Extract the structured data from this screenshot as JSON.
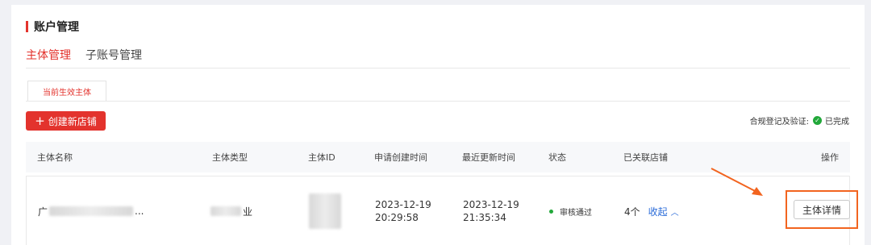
{
  "section": {
    "title": "账户管理"
  },
  "tabs": [
    {
      "label": "主体管理",
      "active": true
    },
    {
      "label": "子账号管理",
      "active": false
    }
  ],
  "subtab": {
    "label": "当前生效主体"
  },
  "toolbar": {
    "create_label": "创建新店铺",
    "compliance_label": "合规登记及验证:",
    "compliance_status": "已完成"
  },
  "table": {
    "headers": [
      "主体名称",
      "主体类型",
      "主体ID",
      "申请创建时间",
      "最近更新时间",
      "状态",
      "已关联店铺",
      "操作"
    ],
    "rows": [
      {
        "name_prefix": "广",
        "name_suffix": "...",
        "type_suffix": "业",
        "created_date": "2023-12-19",
        "created_time": "20:29:58",
        "updated_date": "2023-12-19",
        "updated_time": "21:35:34",
        "status": "审核通过",
        "shops": "4个",
        "collapse_label": "收起",
        "action_label": "主体详情"
      }
    ]
  },
  "colors": {
    "accent": "#e3332d",
    "success": "#22a83a",
    "link": "#2a6bd8",
    "highlight": "#f2641f"
  }
}
